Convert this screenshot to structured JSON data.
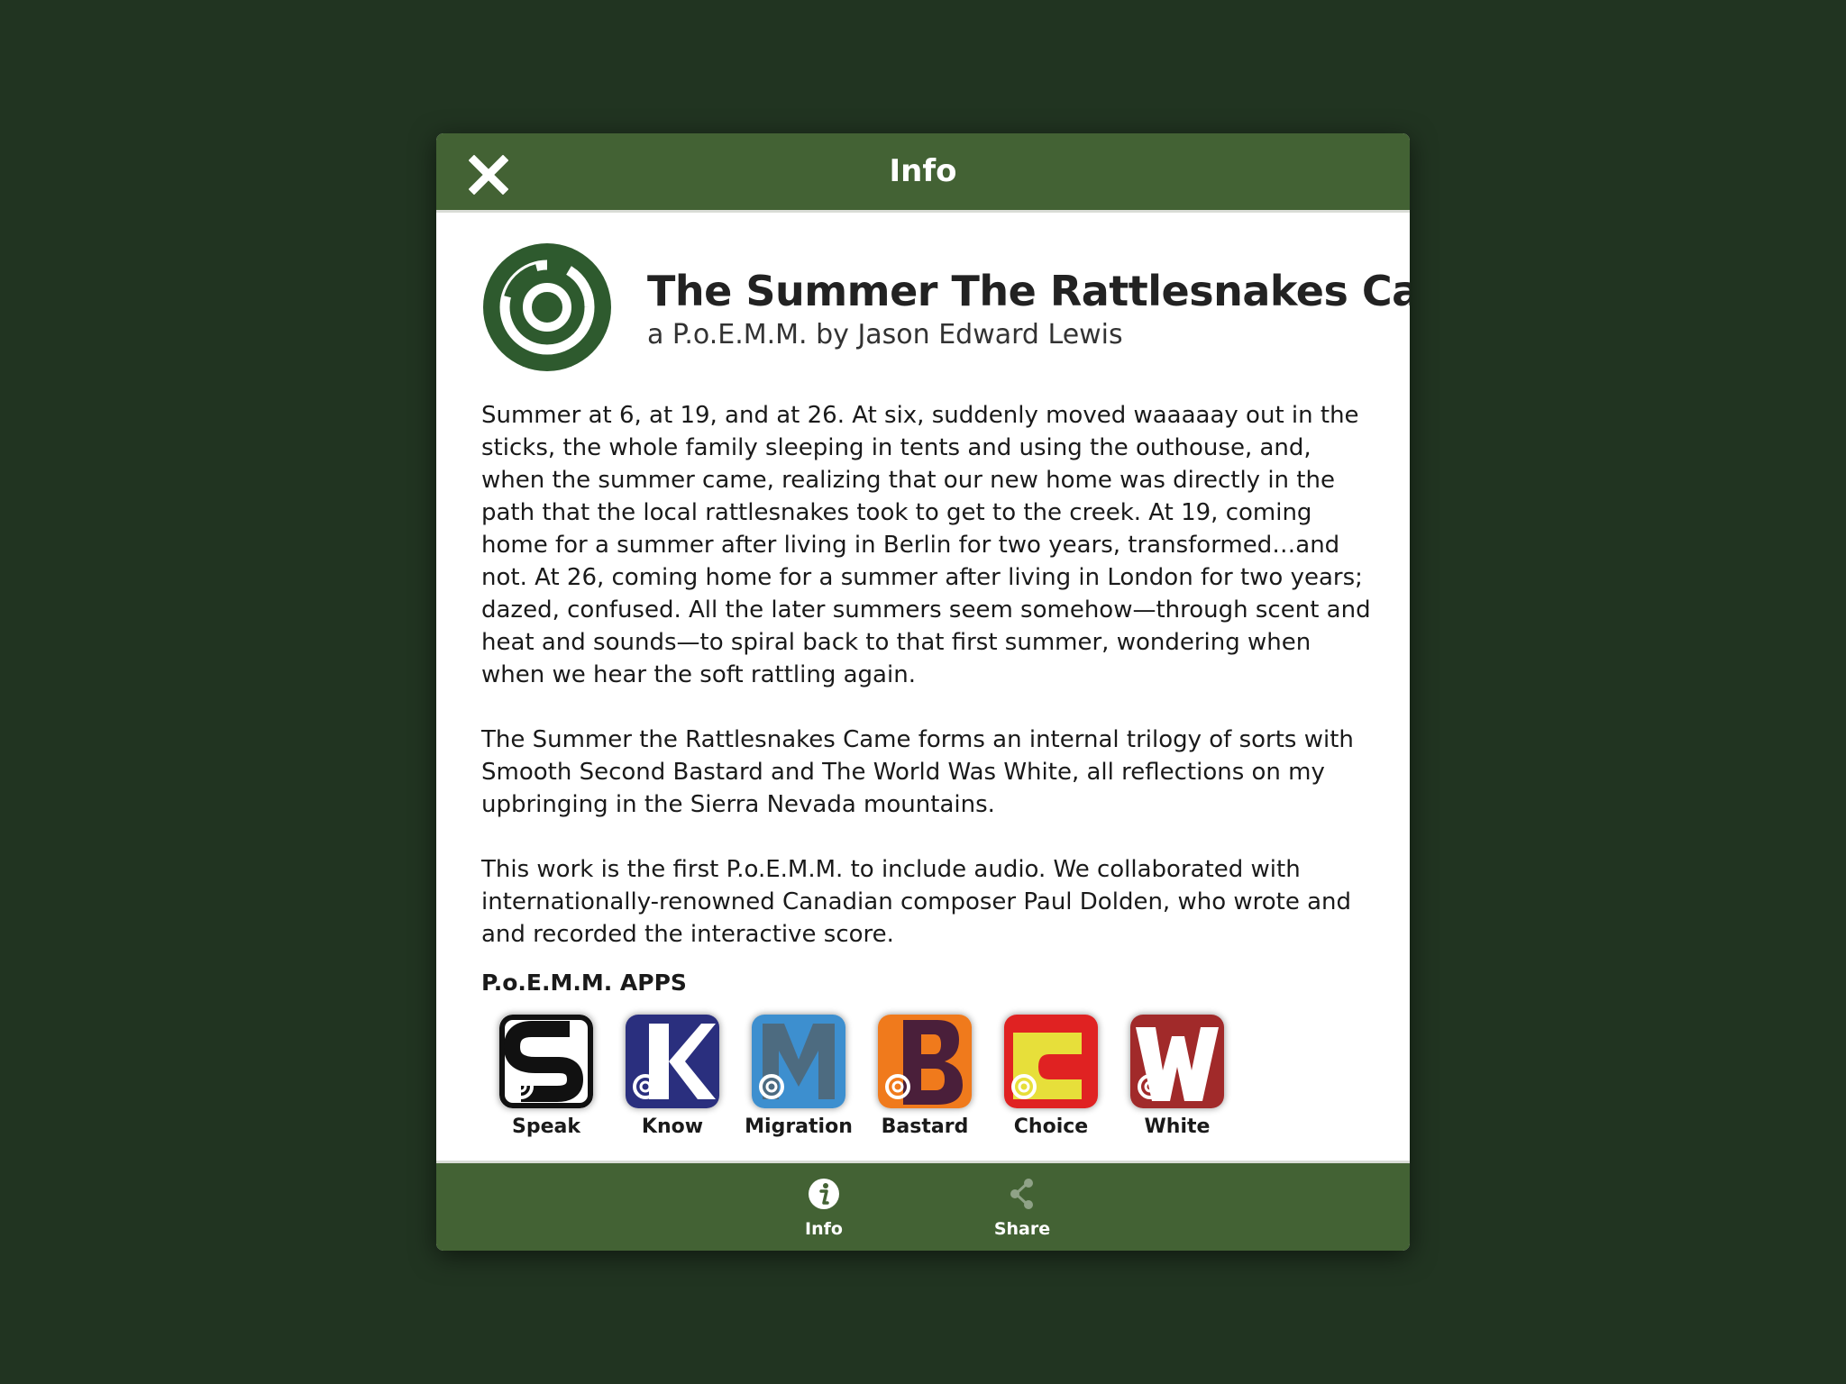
{
  "header": {
    "title": "Info",
    "close_icon": "close-icon"
  },
  "app": {
    "title": "The Summer The Rattlesnakes Came",
    "subtitle": "a P.o.E.M.M. by Jason Edward Lewis",
    "logo_icon": "spiral-logo-icon"
  },
  "description": {
    "paragraphs": [
      "Summer at 6, at 19, and at 26. At six, suddenly moved waaaaay out in the sticks, the whole family sleeping in tents and using the outhouse, and, when the summer came, realizing that our new home was directly in the path that the local rattlesnakes took to get to the creek. At 19, coming home for a summer after living in Berlin for two years, transformed…and not. At 26, coming home for a summer after living in London for two years; dazed, confused. All the later summers seem somehow—through scent and heat and sounds—to spiral back to that first summer, wondering when when we hear the soft rattling again.",
      "The Summer the Rattlesnakes Came forms an internal trilogy of sorts with Smooth Second Bastard and The World Was White, all reflections on my upbringing in the Sierra Nevada mountains.",
      "This work is the first P.o.E.M.M. to include audio. We collaborated with internationally-renowned Canadian composer Paul Dolden, who wrote and and recorded the interactive score."
    ]
  },
  "apps_section": {
    "heading": "P.o.E.M.M. APPS",
    "apps": [
      {
        "label": "Speak",
        "letter": "S",
        "bg": "#ffffff",
        "fg": "#111111"
      },
      {
        "label": "Know",
        "letter": "K",
        "bg": "#2a2f7e",
        "fg": "#ffffff"
      },
      {
        "label": "Migration",
        "letter": "M",
        "bg": "#3d8fcf",
        "fg": "#4d6b80"
      },
      {
        "label": "Bastard",
        "letter": "B",
        "bg": "#f07a1c",
        "fg": "#4a1f3a"
      },
      {
        "label": "Choice",
        "letter": "C",
        "bg": "#e7df3a",
        "fg": "#e02222"
      },
      {
        "label": "White",
        "letter": "W",
        "bg": "#a12a2a",
        "fg": "#ffffff"
      }
    ]
  },
  "bottom_tabs": {
    "info_label": "Info",
    "share_label": "Share"
  },
  "colors": {
    "background": "#213421",
    "bar": "#436234",
    "logo": "#2e5a2e"
  }
}
